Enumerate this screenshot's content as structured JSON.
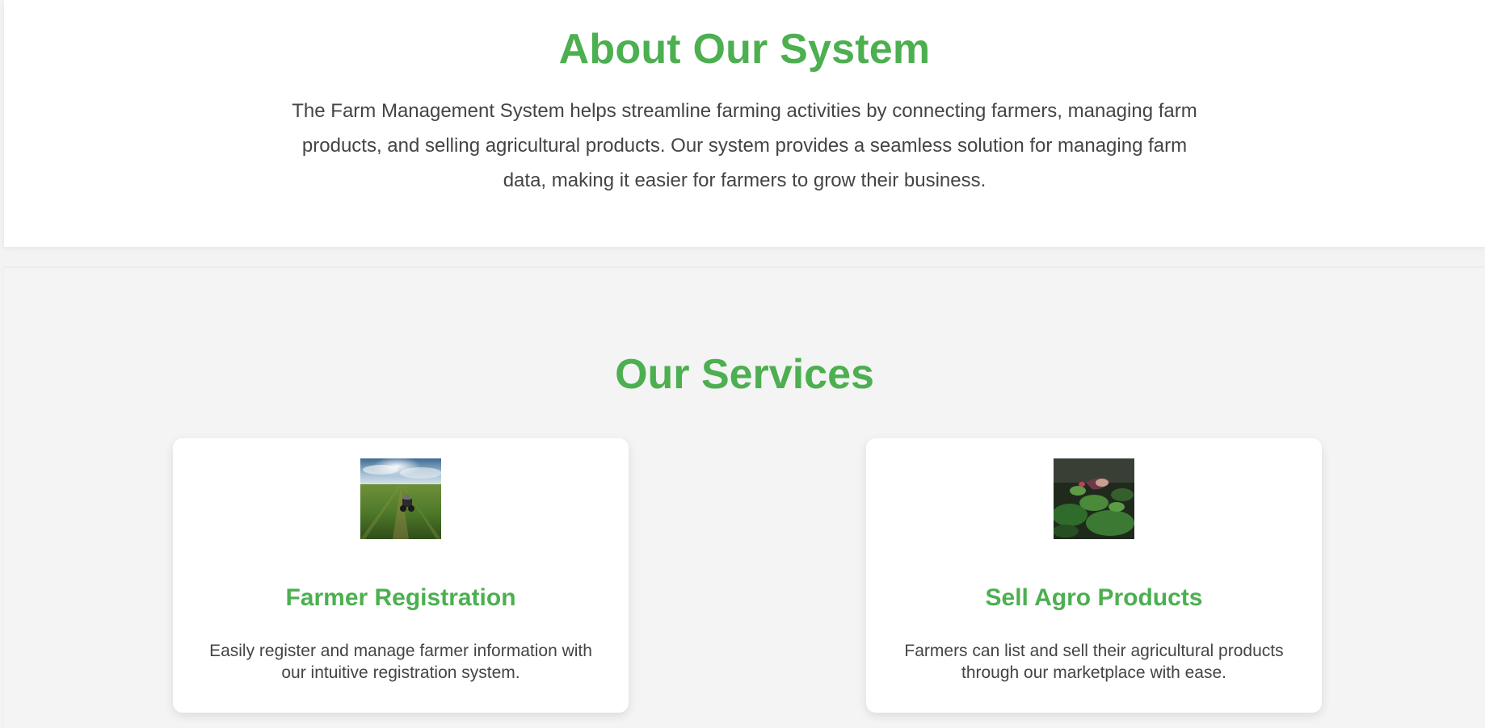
{
  "about": {
    "title": "About Our System",
    "description": "The Farm Management System helps streamline farming activities by connecting farmers, managing farm products, and selling agricultural products. Our system provides a seamless solution for managing farm data, making it easier for farmers to grow their business."
  },
  "services": {
    "title": "Our Services",
    "items": [
      {
        "title": "Farmer Registration",
        "description": "Easily register and manage farmer information with our intuitive registration system.",
        "image": "tractor-field-image"
      },
      {
        "title": "Sell Agro Products",
        "description": "Farmers can list and sell their agricultural products through our marketplace with ease.",
        "image": "plants-harvest-image"
      }
    ]
  },
  "colors": {
    "accent": "#4caf50",
    "text": "#444444",
    "section_bg": "#f4f4f4",
    "card_bg": "#ffffff"
  }
}
